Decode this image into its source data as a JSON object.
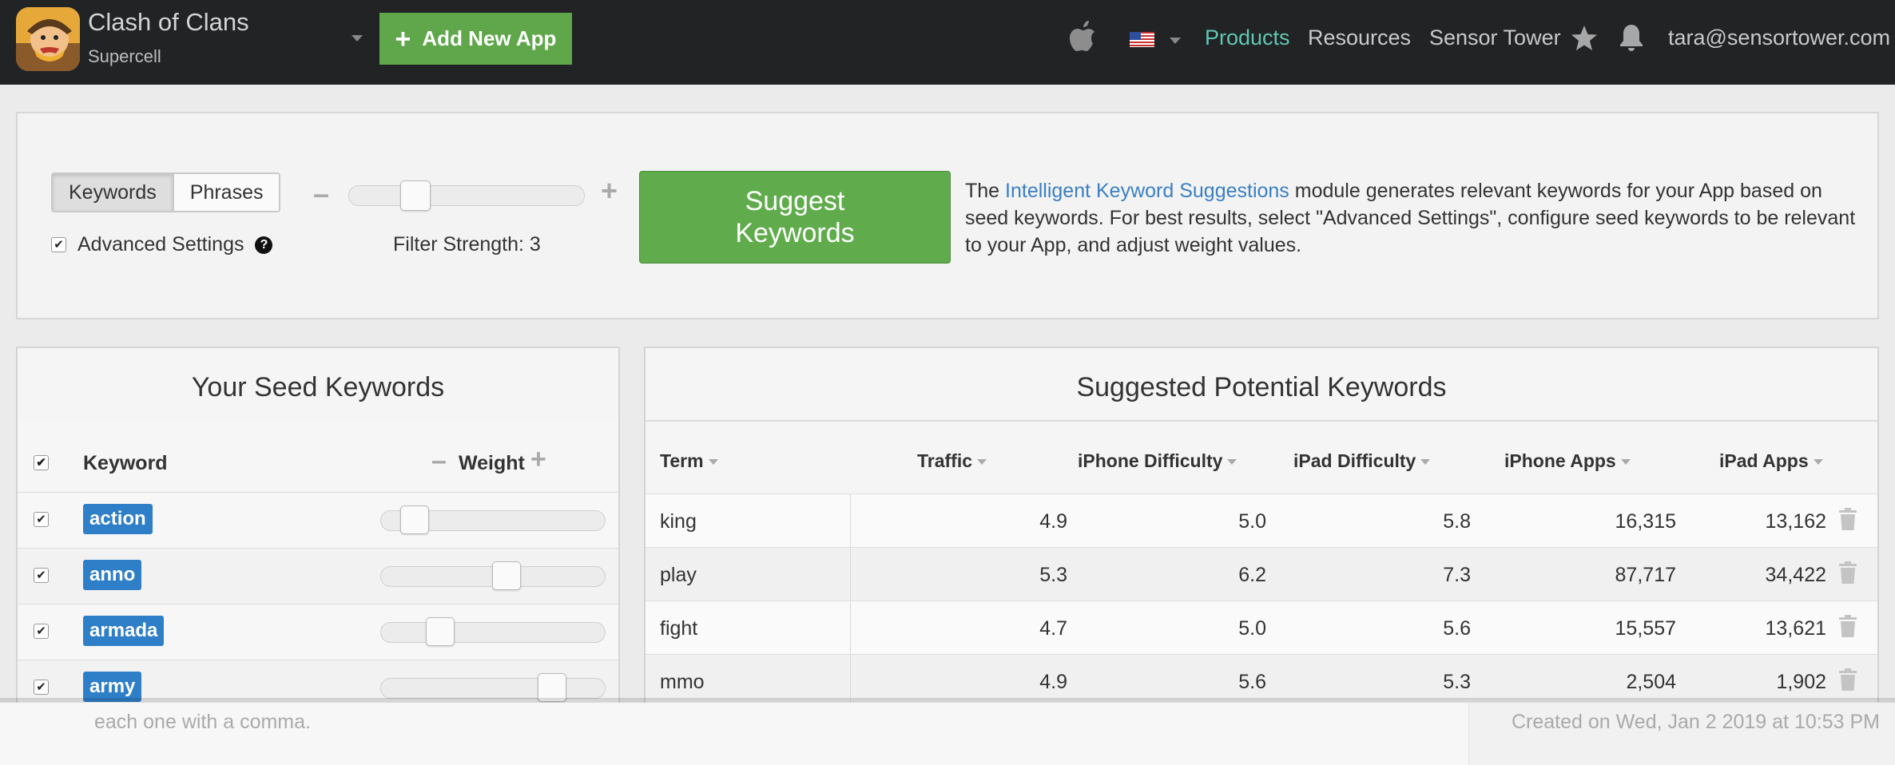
{
  "topbar": {
    "app_name": "Clash of Clans",
    "developer": "Supercell",
    "add_app_label": "Add New App",
    "nav": [
      "Products",
      "Resources",
      "Sensor Tower"
    ],
    "active_nav": "Products",
    "user_email": "tara@sensortower.com",
    "accent_color": "#5fc8b4",
    "add_button_color": "#5fa74a"
  },
  "settings": {
    "mode_tabs": [
      "Keywords",
      "Phrases"
    ],
    "active_mode": "Keywords",
    "advanced_label": "Advanced Settings",
    "advanced_checked": true,
    "filter_label": "Filter Strength: 3",
    "filter_strength": 3,
    "suggest_label_line1": "Suggest",
    "suggest_label_line2": "Keywords",
    "desc_prefix": "The ",
    "desc_link": "Intelligent Keyword Suggestions",
    "desc_suffix": " module generates relevant keywords for your App based on seed keywords. For best results, select \"Advanced Settings\", configure seed keywords to be relevant to your App, and adjust weight values."
  },
  "seed_panel": {
    "title": "Your Seed Keywords",
    "col_keyword": "Keyword",
    "col_weight": "Weight",
    "rows": [
      {
        "keyword": "action",
        "checked": true,
        "weight": 0.1
      },
      {
        "keyword": "anno",
        "checked": true,
        "weight": 0.57
      },
      {
        "keyword": "armada",
        "checked": true,
        "weight": 0.23
      },
      {
        "keyword": "army",
        "checked": true,
        "weight": 0.8
      }
    ]
  },
  "suggest_panel": {
    "title": "Suggested Potential Keywords",
    "columns": [
      "Term",
      "Traffic",
      "iPhone Difficulty",
      "iPad Difficulty",
      "iPhone Apps",
      "iPad Apps"
    ],
    "rows": [
      {
        "term": "king",
        "traffic": "4.9",
        "iphone_diff": "5.0",
        "ipad_diff": "5.8",
        "iphone_apps": "16,315",
        "ipad_apps": "13,162"
      },
      {
        "term": "play",
        "traffic": "5.3",
        "iphone_diff": "6.2",
        "ipad_diff": "7.3",
        "iphone_apps": "87,717",
        "ipad_apps": "34,422"
      },
      {
        "term": "fight",
        "traffic": "4.7",
        "iphone_diff": "5.0",
        "ipad_diff": "5.6",
        "iphone_apps": "15,557",
        "ipad_apps": "13,621"
      },
      {
        "term": "mmo",
        "traffic": "4.9",
        "iphone_diff": "5.6",
        "ipad_diff": "5.3",
        "iphone_apps": "2,504",
        "ipad_apps": "1,902"
      }
    ]
  },
  "footer": {
    "left_text": "each one with a comma.",
    "right_text": "Created on Wed, Jan 2 2019 at 10:53 PM"
  }
}
